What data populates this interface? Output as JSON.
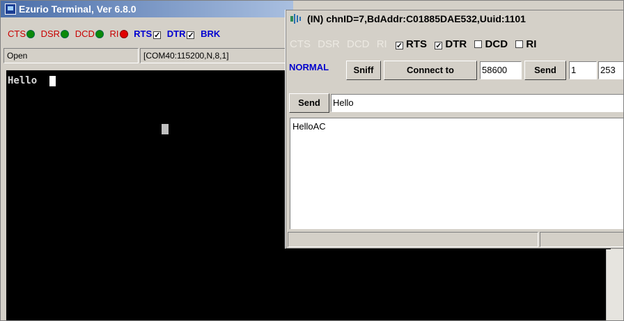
{
  "main_window": {
    "title": "Ezurio Terminal, Ver 6.8.0",
    "signals": [
      {
        "label": "CTS",
        "led": "green"
      },
      {
        "label": "DSR",
        "led": "green"
      },
      {
        "label": "DCD",
        "led": "green"
      },
      {
        "label": "RI",
        "led": "red"
      }
    ],
    "controls": [
      {
        "label": "RTS",
        "checked": true
      },
      {
        "label": "DTR",
        "checked": true
      },
      {
        "label": "BRK",
        "checked": false
      }
    ],
    "status_open": "Open",
    "status_port": "[COM40:115200,N,8,1]",
    "terminal_text": "Hello"
  },
  "child_window": {
    "title": "(IN) chnID=7,BdAddr:C01885DAE532,Uuid:1101",
    "signals": [
      "CTS",
      "DSR",
      "DCD",
      "RI"
    ],
    "controls": [
      {
        "label": "RTS",
        "checked": true
      },
      {
        "label": "DTR",
        "checked": true
      },
      {
        "label": "DCD",
        "checked": false
      },
      {
        "label": "RI",
        "checked": false
      }
    ],
    "mode": "NORMAL",
    "sniff_label": "Sniff",
    "connect_label": "Connect to",
    "connect_value": "58600",
    "send_label": "Send",
    "send_count": "1",
    "send_size": "253",
    "send2_label": "Send",
    "send_text": "Hello",
    "output_text": "HelloAC"
  },
  "colors": {
    "signal_red": "#c80000",
    "signal_blue": "#0000d0",
    "led_green": "#0a8a0a",
    "led_red": "#e00000",
    "terminal_bg": "#000000",
    "mode_blue": "#0000cc"
  }
}
